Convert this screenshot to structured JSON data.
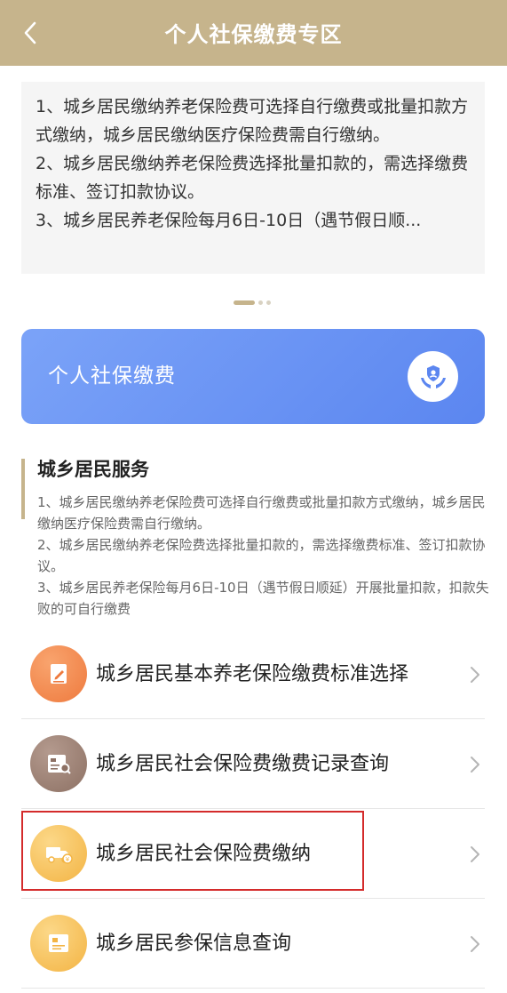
{
  "header": {
    "title": "个人社保缴费专区"
  },
  "notice": {
    "line1": "1、城乡居民缴纳养老保险费可选择自行缴费或批量扣款方式缴纳，城乡居民缴纳医疗保险费需自行缴纳。",
    "line2": "2、城乡居民缴纳养老保险费选择批量扣款的，需选择缴费标准、签订扣款协议。",
    "line3": "3、城乡居民养老保险每月6日-10日（遇节假日顺..."
  },
  "banner": {
    "label": "个人社保缴费"
  },
  "section": {
    "title": "城乡居民服务",
    "desc1": "1、城乡居民缴纳养老保险费可选择自行缴费或批量扣款方式缴纳，城乡居民缴纳医疗保险费需自行缴纳。",
    "desc2": "2、城乡居民缴纳养老保险费选择批量扣款的，需选择缴费标准、签订扣款协议。",
    "desc3": "3、城乡居民养老保险每月6日-10日（遇节假日顺延）开展批量扣款，扣款失败的可自行缴费"
  },
  "menu": [
    {
      "label": "城乡居民基本养老保险缴费标准选择",
      "icon": "edit-form-icon"
    },
    {
      "label": "城乡居民社会保险费缴费记录查询",
      "icon": "record-search-icon"
    },
    {
      "label": "城乡居民社会保险费缴纳",
      "icon": "payment-truck-icon"
    },
    {
      "label": "城乡居民参保信息查询",
      "icon": "id-card-icon"
    }
  ],
  "colors": {
    "header_bg": "#c6b48c",
    "banner_gradient_start": "#7ba3f8",
    "banner_gradient_end": "#5b86f0",
    "highlight_border": "#d42b2b"
  }
}
